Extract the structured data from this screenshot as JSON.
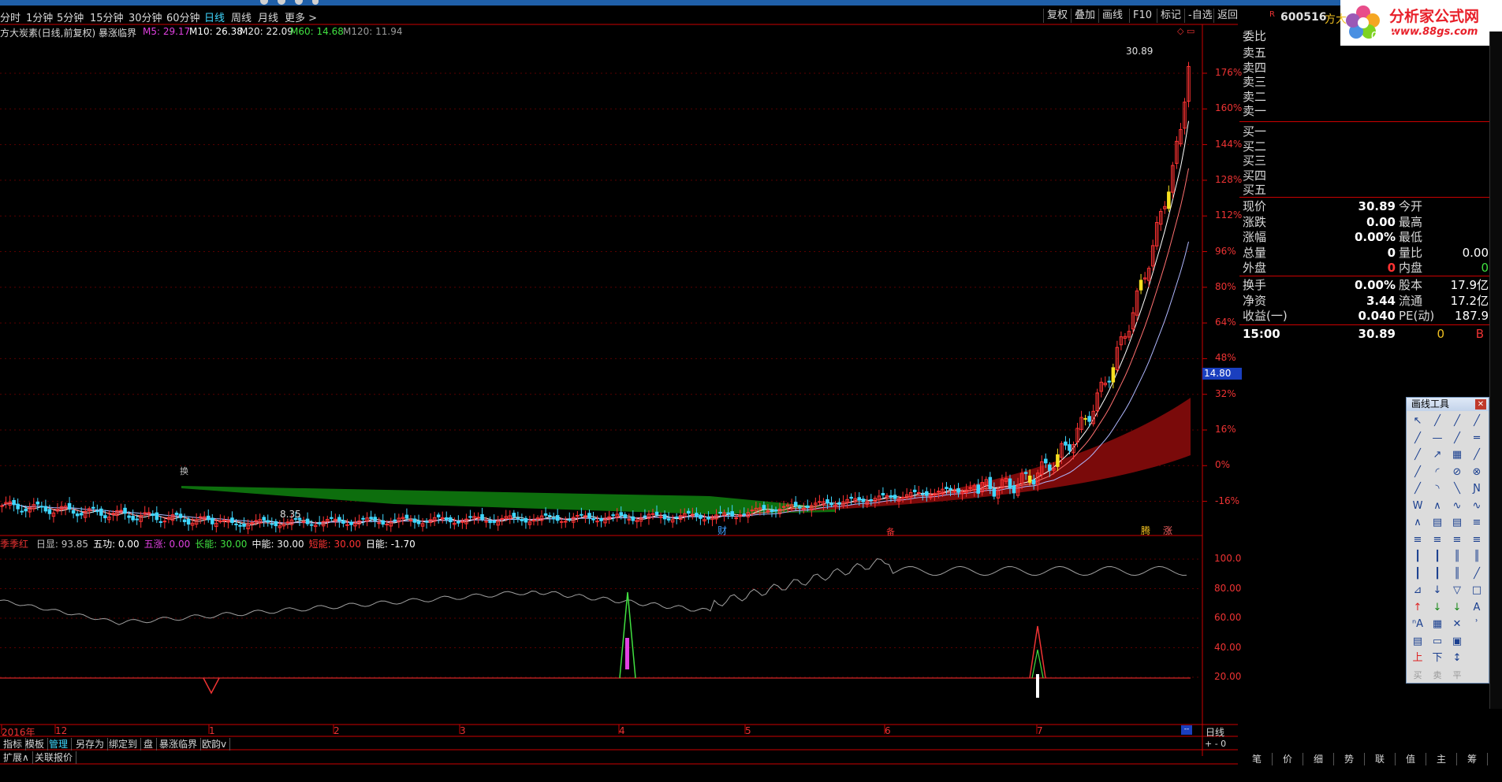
{
  "toolbar": {
    "timeframes": [
      "分时",
      "1分钟",
      "5分钟",
      "15分钟",
      "30分钟",
      "60分钟",
      "日线",
      "周线",
      "月线",
      "更多 >"
    ],
    "active": "日线",
    "right_buttons": [
      "复权",
      "叠加",
      "画线",
      "F10",
      "标记",
      "-自选",
      "返回"
    ]
  },
  "chart_header": {
    "title": "方大炭素(日线,前复权) 暴涨临界",
    "ma5": "M5: 29.17",
    "ma10": "M10: 26.38",
    "ma20": "M20: 22.09",
    "ma60": "M60: 14.68",
    "ma120": "M120: 11.94"
  },
  "colors": {
    "up": "#ff3333",
    "down": "#3fd7ff",
    "ma5": "#ffffff",
    "ma10": "#ff6c6c",
    "ma20": "#e0e0ff",
    "ma60": "#e8e840",
    "ma120": "#4fbf4f",
    "band_green": "#0d7a0d",
    "band_red": "#7a0a0a",
    "label_red": "#e33333",
    "yellow": "#f7e020"
  },
  "price_axis": {
    "ticks": [
      "176%",
      "160%",
      "144%",
      "128%",
      "112%",
      "96%",
      "80%",
      "64%",
      "48%",
      "32%",
      "16%",
      "0%",
      "-16%"
    ],
    "current_tag": "14.80"
  },
  "annotations": {
    "high": "30.89",
    "low": "8.35",
    "cai": "财",
    "jia": "备",
    "tu": "腾",
    "zhang": "涨",
    "huan": "换"
  },
  "indicator": {
    "name": "季季红",
    "items": [
      {
        "label": "日显: 93.85",
        "color": "#c0c0c0"
      },
      {
        "label": "五功: 0.00",
        "color": "#ffffff"
      },
      {
        "label": "五涨: 0.00",
        "color": "#e040e0"
      },
      {
        "label": "长能: 30.00",
        "color": "#40e040"
      },
      {
        "label": "中能: 30.00",
        "color": "#f0f0f0"
      },
      {
        "label": "短能: 30.00",
        "color": "#ff3333"
      },
      {
        "label": "日能: -1.70",
        "color": "#ffffff"
      }
    ],
    "ticks": [
      "100.0",
      "80.00",
      "60.00",
      "40.00",
      "20.00"
    ]
  },
  "date_axis": {
    "labels": [
      "2016年",
      "12",
      "1",
      "2",
      "3",
      "4",
      "5",
      "6",
      "7"
    ]
  },
  "bottom_tabs": [
    "指标",
    "模板",
    "管理",
    "另存为",
    "绑定到",
    "盘",
    "暴涨临界",
    "欧韵v"
  ],
  "bottom_tabs2": [
    "扩展∧",
    "关联报价"
  ],
  "period_label": "日线",
  "quote": {
    "code": "600516",
    "name": "方大",
    "weibi_label": "委比",
    "weibi": "0.00",
    "sell": [
      "卖五",
      "卖四",
      "卖三",
      "卖二",
      "卖一"
    ],
    "buy": [
      "买一",
      "买二",
      "买三",
      "买四",
      "买五"
    ],
    "stats": [
      {
        "l1": "现价",
        "v1": "30.89",
        "l2": "今开",
        "v2": ""
      },
      {
        "l1": "涨跌",
        "v1": "0.00",
        "l2": "最高",
        "v2": ""
      },
      {
        "l1": "涨幅",
        "v1": "0.00%",
        "l2": "最低",
        "v2": ""
      },
      {
        "l1": "总量",
        "v1": "0",
        "l2": "量比",
        "v2": "0.00"
      },
      {
        "l1": "外盘",
        "v1": "0",
        "l2": "内盘",
        "v2": "0"
      }
    ],
    "stats2": [
      {
        "l1": "换手",
        "v1": "0.00%",
        "l2": "股本",
        "v2": "17.9亿"
      },
      {
        "l1": "净资",
        "v1": "3.44",
        "l2": "流通",
        "v2": "17.2亿"
      },
      {
        "l1": "收益(一)",
        "v1": "0.040",
        "l2": "PE(动)",
        "v2": "187.9"
      }
    ],
    "tick": {
      "time": "15:00",
      "price": "30.89",
      "vol": "0",
      "flag": "B"
    },
    "tabs": [
      "笔",
      "价",
      "细",
      "势",
      "联",
      "值",
      "主",
      "筹"
    ]
  },
  "drawing_tool": {
    "title": "画线工具"
  },
  "logo": {
    "text": "分析家公式网",
    "url": "www.88gs.com"
  }
}
